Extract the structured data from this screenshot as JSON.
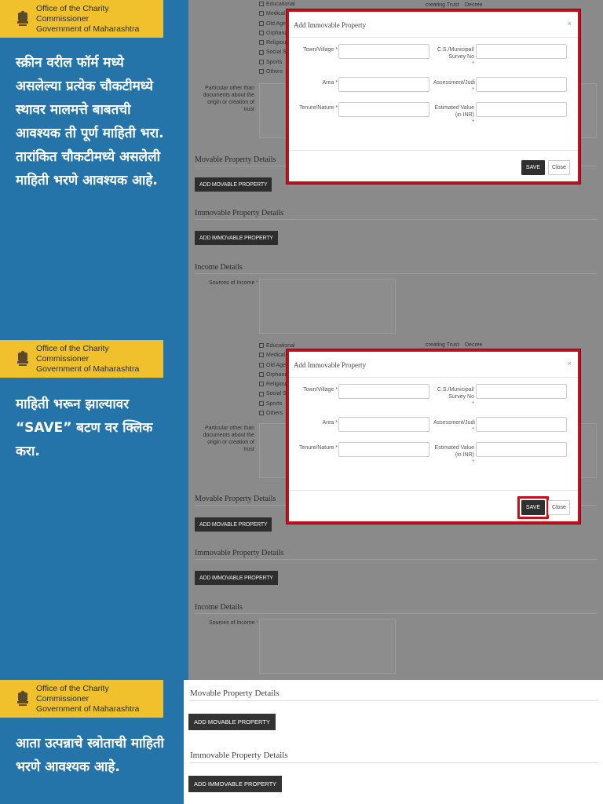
{
  "header": {
    "org_line1": "Office of the Charity Commissioner",
    "org_line2": "Government of Maharashtra"
  },
  "colors": {
    "panel": "#2474a9",
    "logo_bg": "#f1c12d",
    "highlight": "#c1121f"
  },
  "steps": [
    {
      "text": "स्क्रीन वरील फॉर्म मध्ये असलेल्या प्रत्येक चौकटीमध्ये स्थावर मालमत्ते बाबतची आवश्यक ती पूर्ण माहिती भरा.",
      "text2": "तारांकित चौकटीमध्ये असलेली माहिती भरणे आवश्यक आहे."
    },
    {
      "text": "माहिती भरून झाल्यावर “SAVE” बटण वर क्लिक करा."
    },
    {
      "text": "आता उत्पन्नाचे स्त्रोताची माहिती भरणे आवश्यक आहे."
    }
  ],
  "form": {
    "objects": [
      "Educational",
      "Medical",
      "Old Age",
      "Orphanage",
      "Religious",
      "Social Se",
      "Sports",
      "Others"
    ],
    "creating_trust": "creating Trust",
    "decree": "Decree",
    "particular_label": "Particular other than documents about the origin or creation of trust",
    "movable_title": "Movable Property Details",
    "add_movable": "ADD MOVABLE PROPERTY",
    "immovable_title": "Immovable Property Details",
    "add_immovable": "ADD IMMOVABLE PROPERTY",
    "income_title": "Income Details",
    "sources_label": "Sources of Income"
  },
  "modal": {
    "title": "Add Immovable Property",
    "close_x": "×",
    "town_label": "Town/Village",
    "cs_label": "C.S./Municipal/ Survey No",
    "area_label": "Area",
    "assessment_label": "Assessment/Judi",
    "tenure_label": "Tenure/Nature",
    "estimated_label": "Estimated Value (in INR)",
    "required": "*",
    "save": "SAVE",
    "close": "Close"
  }
}
